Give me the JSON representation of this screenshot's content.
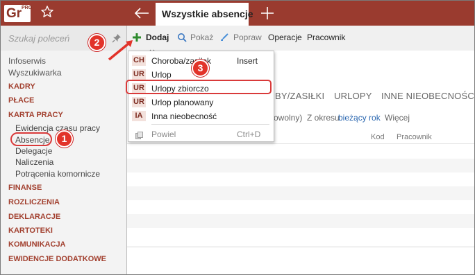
{
  "app": {
    "logo_text": "Gr",
    "logo_sup": "PRO",
    "active_tab": "Wszystkie absencje"
  },
  "sidebar": {
    "search_placeholder": "Szukaj poleceń",
    "items": [
      {
        "label": "Infoserwis",
        "kind": "item"
      },
      {
        "label": "Wyszukiwarka",
        "kind": "item"
      },
      {
        "label": "KADRY",
        "kind": "section"
      },
      {
        "label": "PŁACE",
        "kind": "section"
      },
      {
        "label": "KARTA PRACY",
        "kind": "section"
      },
      {
        "label": "Ewidencja czasu pracy",
        "kind": "sub"
      },
      {
        "label": "Absencje",
        "kind": "sub"
      },
      {
        "label": "Delegacje",
        "kind": "sub"
      },
      {
        "label": "Naliczenia",
        "kind": "sub"
      },
      {
        "label": "Potrącenia komornicze",
        "kind": "sub"
      },
      {
        "label": "FINANSE",
        "kind": "section"
      },
      {
        "label": "ROZLICZENIA",
        "kind": "section"
      },
      {
        "label": "DEKLARACJE",
        "kind": "section"
      },
      {
        "label": "KARTOTEKI",
        "kind": "section"
      },
      {
        "label": "KOMUNIKACJA",
        "kind": "section"
      },
      {
        "label": "EWIDENCJE DODATKOWE",
        "kind": "section"
      }
    ]
  },
  "toolbar": {
    "add": "Dodaj",
    "show": "Pokaż",
    "fix": "Popraw",
    "operations": "Operacje",
    "employee": "Pracownik"
  },
  "content": {
    "tabs": [
      "BY/ZASIŁKI",
      "URLOPY",
      "INNE NIEOBECNOŚCI"
    ],
    "filter_prefix": "owolny)",
    "filter_period_label": "Z okresu",
    "filter_period_value": "bieżący rok",
    "filter_more": "Więcej",
    "col_code": "Kod",
    "col_employee": "Pracownik"
  },
  "dropdown": {
    "items": [
      {
        "code": "CH",
        "label": "Choroba/zasiłek",
        "shortcut": "Insert"
      },
      {
        "code": "UR",
        "label": "Urlop",
        "shortcut": ""
      },
      {
        "code": "UR",
        "label": "Urlopy zbiorczo",
        "shortcut": ""
      },
      {
        "code": "UR",
        "label": "Urlop planowany",
        "shortcut": ""
      },
      {
        "code": "IA",
        "label": "Inna nieobecność",
        "shortcut": ""
      }
    ],
    "repeat": {
      "label": "Powiel",
      "shortcut": "Ctrl+D"
    }
  },
  "annotations": {
    "step1": "1",
    "step2": "2",
    "step3": "3"
  },
  "colors": {
    "brand": "#9a3b2f",
    "section_text": "#a2402f",
    "highlight": "#d93a3a",
    "link": "#2b67b0",
    "add_green": "#2e8b2e"
  }
}
